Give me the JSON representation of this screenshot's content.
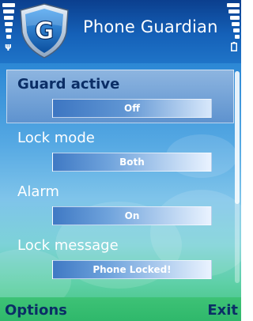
{
  "title_bar": {
    "app_title": "Phone Guardian",
    "app_icon_letter": "G",
    "signal_icon": "signal-strength-icon",
    "battery_icon": "battery-level-icon"
  },
  "settings": [
    {
      "label": "Guard active",
      "value": "Off",
      "selected": true
    },
    {
      "label": "Lock mode",
      "value": "Both",
      "selected": false
    },
    {
      "label": "Alarm",
      "value": "On",
      "selected": false
    },
    {
      "label": "Lock message",
      "value": "Phone Locked!",
      "selected": false
    }
  ],
  "softkeys": {
    "left": "Options",
    "right": "Exit"
  },
  "colors": {
    "title_bar": "#1561b8",
    "selected_item": "#7ea9da",
    "softkey_text": "#0b2e66",
    "softkey_bar": "#3ec276"
  }
}
